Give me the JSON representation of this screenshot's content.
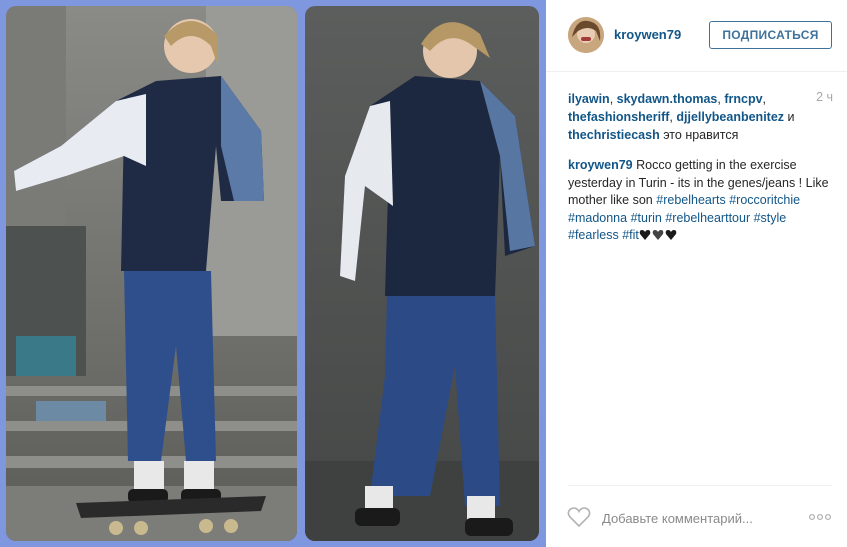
{
  "photos": [
    {
      "name": "photo-left",
      "subject": "skateboarder on board"
    },
    {
      "name": "photo-right",
      "subject": "skateboarder standing"
    }
  ],
  "post": {
    "username": "kroywen79",
    "follow_label": "ПОДПИСАТЬСЯ",
    "time": "2 ч",
    "likes": {
      "users": [
        "ilyawin",
        "skydawn.thomas",
        "frncpv",
        "thefashionsheriff",
        "djjellybeanbenitez",
        "thechristiecash"
      ],
      "conjunction": "и",
      "suffix": "это нравится"
    },
    "caption": {
      "author": "kroywen79",
      "text": "Rocco getting in the exercise yesterday in Turin - its in the genes/jeans ! Like mother like son",
      "tags": [
        "#rebelhearts",
        "#roccoritchie",
        "#madonna",
        "#turin",
        "#rebelhearttour",
        "#style",
        "#fearless",
        "#fit"
      ]
    },
    "comment_placeholder": "Добавьте комментарий...",
    "icons": {
      "like": "heart-outline-icon",
      "more": "more-dots-icon"
    }
  },
  "colors": {
    "link": "#125688",
    "follow": "#3f729b",
    "frame": "#7f97df"
  }
}
